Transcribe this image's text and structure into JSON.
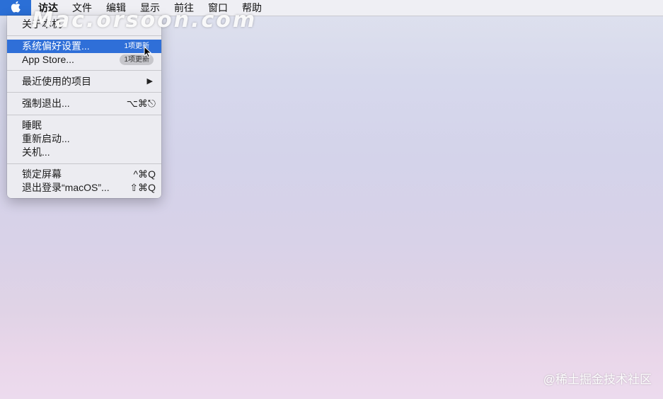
{
  "menubar": {
    "apple_icon": "apple-logo-icon",
    "items": [
      "访达",
      "文件",
      "编辑",
      "显示",
      "前往",
      "窗口",
      "帮助"
    ]
  },
  "apple_menu": {
    "about": "关于本机",
    "system_prefs": "系统偏好设置...",
    "system_prefs_badge": "1项更新",
    "app_store": "App Store...",
    "app_store_badge": "1项更新",
    "recent_items": "最近使用的项目",
    "force_quit": "强制退出...",
    "force_quit_shortcut": "⌥⌘⎋",
    "sleep": "睡眠",
    "restart": "重新启动...",
    "shutdown": "关机...",
    "lock_screen": "锁定屏幕",
    "lock_screen_shortcut": "^⌘Q",
    "logout": "退出登录“macOS”...",
    "logout_shortcut": "⇧⌘Q"
  },
  "watermarks": {
    "top": "Mac.orsoon.com",
    "bottom": "@稀土掘金技术社区"
  },
  "colors": {
    "highlight": "#2f6fd8",
    "apple_menu_active": "#2b6fd6"
  }
}
